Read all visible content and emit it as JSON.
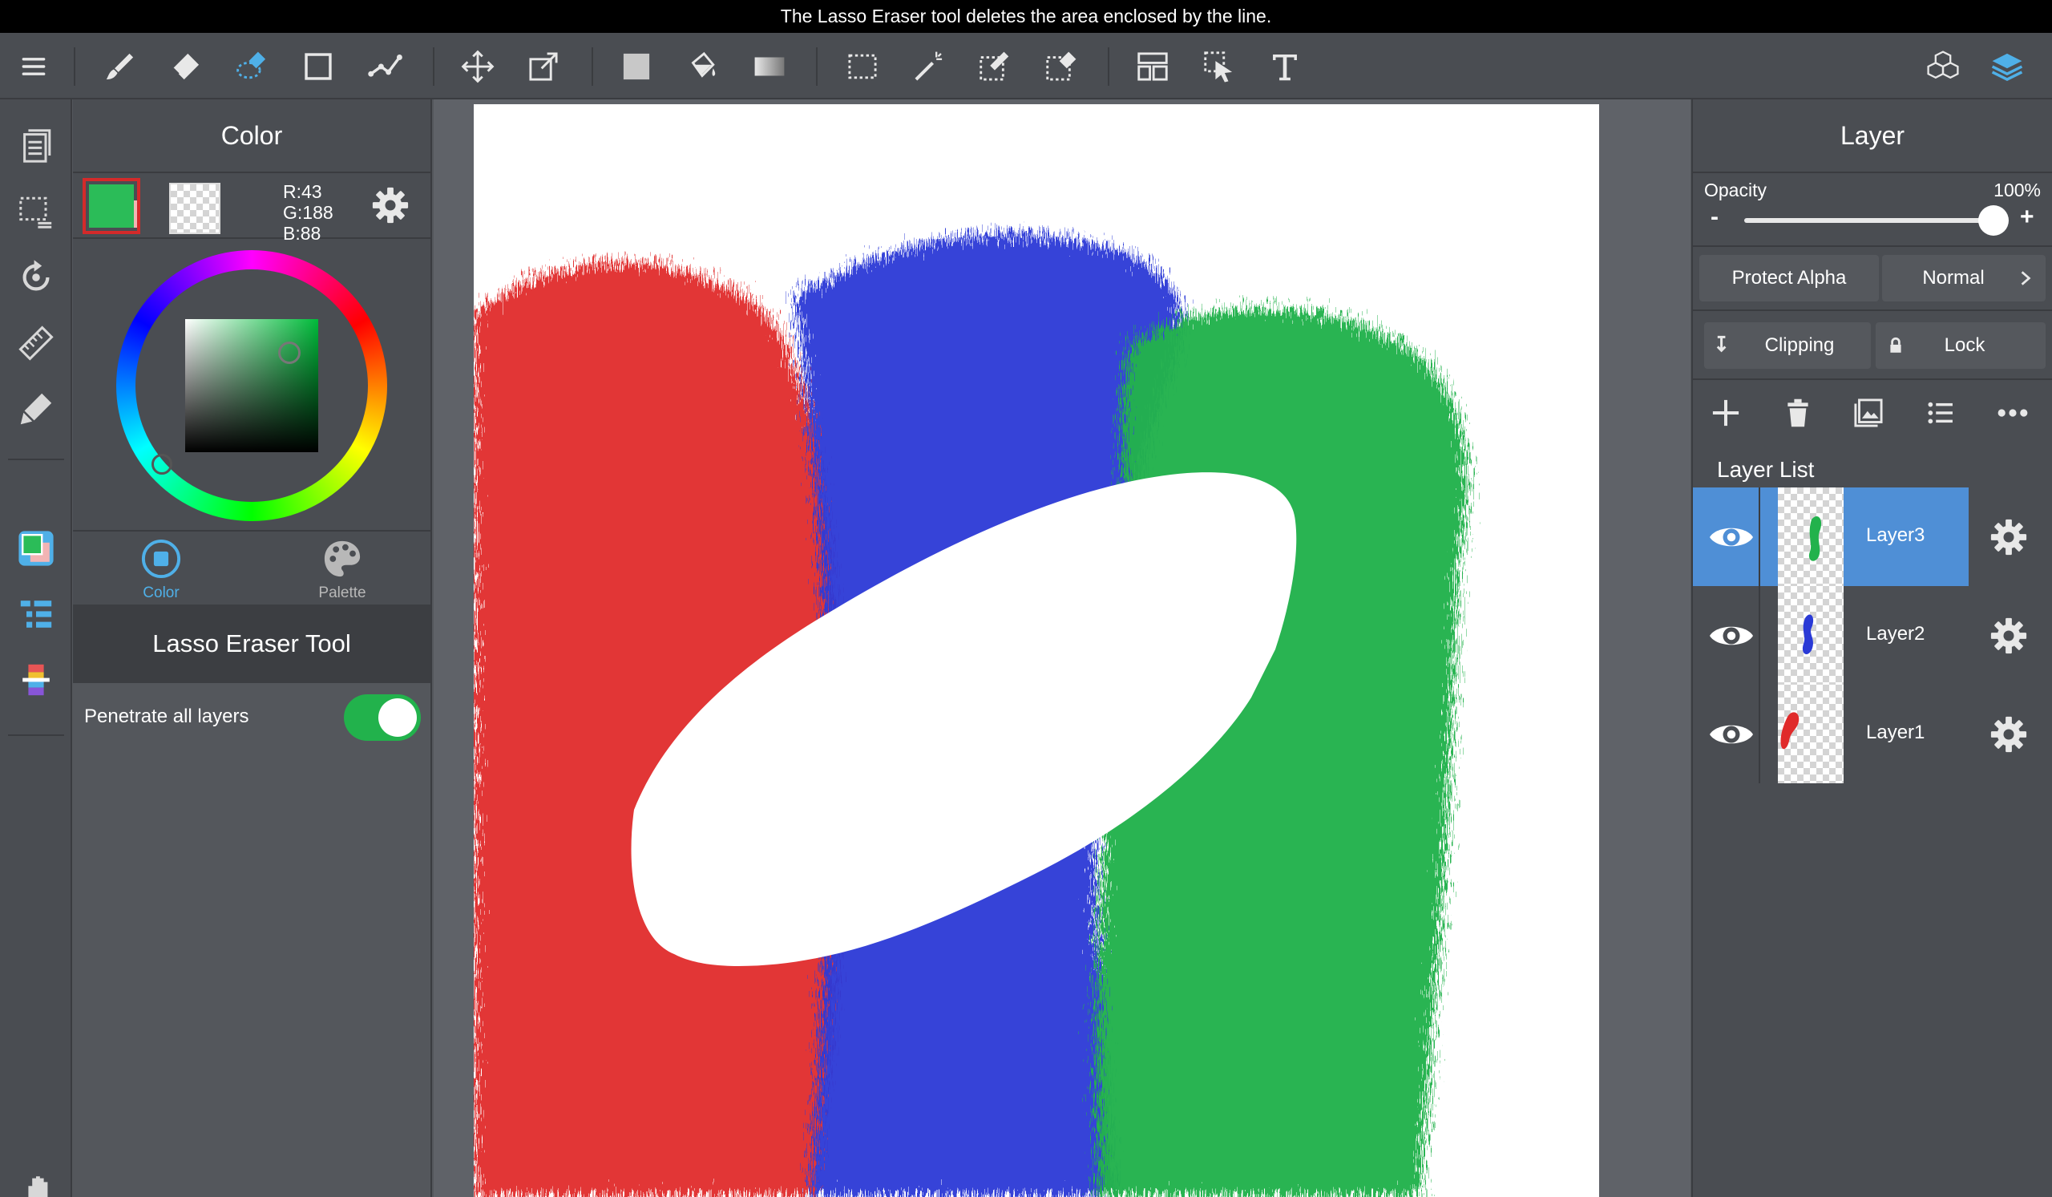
{
  "banner": {
    "message": "The Lasso Eraser tool deletes the area enclosed by the line."
  },
  "toolbar": {
    "icons": [
      "menu-icon",
      "brush-icon",
      "eraser-icon",
      "lasso-eraser-icon",
      "rectangle-icon",
      "dot-icon",
      "move-icon",
      "transform-icon",
      "fill-icon",
      "bucket-icon",
      "gradient-icon",
      "select-icon",
      "magic-wand-icon",
      "select-pen-icon",
      "select-eraser-icon",
      "layout-icon",
      "operation-icon",
      "text-icon",
      "material-icon",
      "layer-icon"
    ]
  },
  "rail": {
    "icons": [
      "page-icon",
      "selection-icon",
      "rotate-icon",
      "ruler-icon",
      "snap-pen-icon",
      "color-swatch-icon",
      "brush-list-icon",
      "color-bar-icon",
      "hand-icon"
    ]
  },
  "color_panel": {
    "title": "Color",
    "main_color": "#2bbc58",
    "sub_color": "#f2b4b4",
    "rgb": {
      "r": "R:43",
      "g": "G:188",
      "b": "B:88"
    },
    "tabs": [
      {
        "label": "Color",
        "active": true
      },
      {
        "label": "Palette",
        "active": false
      }
    ]
  },
  "tool_panel": {
    "title": "Lasso Eraser Tool",
    "penetrate_label": "Penetrate all layers",
    "penetrate_on": true
  },
  "layer_panel": {
    "title": "Layer",
    "opacity_label": "Opacity",
    "opacity_value": "100%",
    "opacity_fraction": 1.0,
    "minus": "-",
    "plus": "+",
    "protect_alpha": "Protect Alpha",
    "blend_mode": "Normal",
    "clipping": "Clipping",
    "lock": "Lock",
    "list_title": "Layer List",
    "layers": [
      {
        "name": "Layer3",
        "selected": true,
        "color": "#22b24c"
      },
      {
        "name": "Layer2",
        "selected": false,
        "color": "#2a3ad6"
      },
      {
        "name": "Layer1",
        "selected": false,
        "color": "#e02a2a"
      }
    ]
  },
  "colors": {
    "accent": "#4f8fd6",
    "toggle_on": "#22b24c",
    "red": "#e02a2a",
    "blue": "#2a3ad6",
    "green": "#22b24c"
  }
}
